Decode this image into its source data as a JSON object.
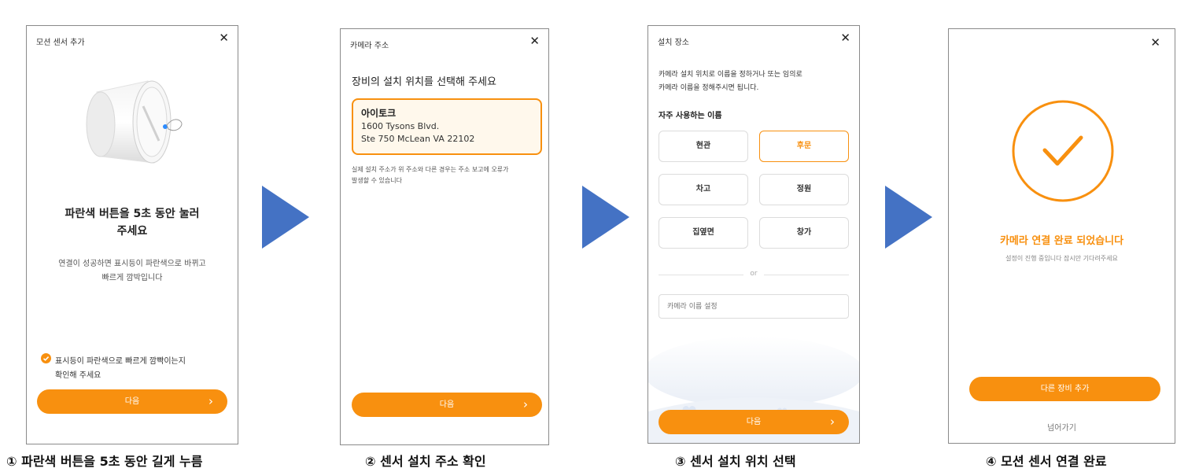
{
  "steps": [
    {
      "title": "모션 센서 추가",
      "close": "✕",
      "headline_line1": "파란색 버튼을 5초 동안 눌러",
      "headline_line2": "주세요",
      "desc_line1": "연결이 성공하면 표시등이 파란색으로 바뀌고",
      "desc_line2": "빠르게 깜박입니다",
      "confirm_line1": "표시등이 파란색으로 빠르게 깜빡이는지",
      "confirm_line2": "확인해 주세요",
      "confirm_checked": true,
      "next_label": "다음",
      "next_chevron": "›",
      "caption": "① 파란색 버튼을 5초 동안 길게 누름"
    },
    {
      "title": "카메라 주소",
      "close": "✕",
      "prompt": "장비의 설치 위치를 선택해 주세요",
      "address_name": "아이토크",
      "address_line1": "1600 Tysons Blvd.",
      "address_line2": "Ste 750 McLean VA 22102",
      "note_line1": "실제 설치 주소가 위 주소와 다른 경우는 주소 보고에 오류가",
      "note_line2": "발생할 수 있습니다",
      "next_label": "다음",
      "next_chevron": "›",
      "caption": "② 센서 설치 주소 확인"
    },
    {
      "title": "설치 장소",
      "close": "✕",
      "desc_line1": "카메라 설치 위치로 이름을 정하거나 또는 임의로",
      "desc_line2": "카메라 이름을 정해주시면 됩니다.",
      "section_label": "자주 사용하는 이름",
      "names": [
        "현관",
        "후문",
        "차고",
        "정원",
        "집옆면",
        "창가"
      ],
      "selected_name": "후문",
      "or_label": "or",
      "name_input_placeholder": "카메라 이름 설정",
      "next_label": "다음",
      "next_chevron": "›",
      "caption": "③ 센서 설치 위치 선택"
    },
    {
      "close": "✕",
      "success_title": "카메라 연결 완료 되었습니다",
      "success_sub": "설정이 진행 중입니다 잠시만 기다려주세요",
      "add_device_label": "다른 장비 추가",
      "skip_label": "넘어가기",
      "caption": "④ 모션 센서 연결 완료"
    }
  ],
  "colors": {
    "accent": "#f8900f",
    "arrow": "#4472c4",
    "selected_bg": "#fff8ec"
  }
}
